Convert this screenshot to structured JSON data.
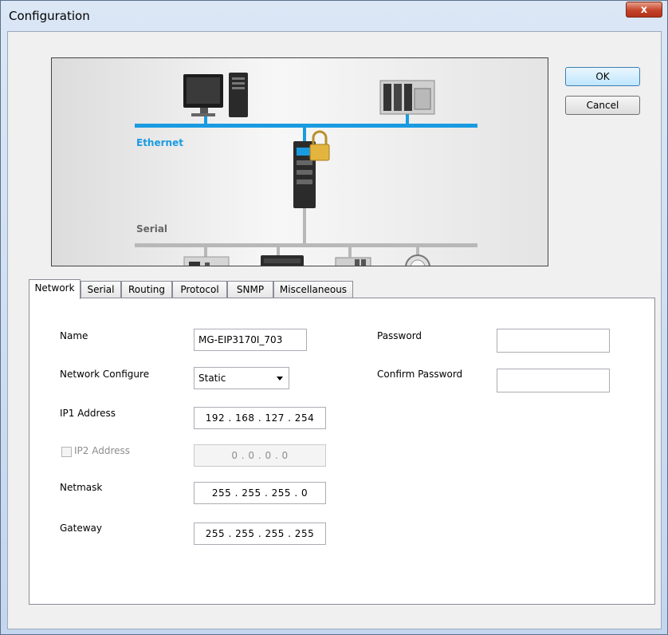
{
  "window": {
    "title": "Configuration",
    "close_label": "x"
  },
  "diagram": {
    "ethernet_label": "Ethernet",
    "serial_label": "Serial"
  },
  "buttons": {
    "ok": "OK",
    "cancel": "Cancel"
  },
  "tabs": [
    {
      "label": "Network",
      "active": true
    },
    {
      "label": "Serial",
      "active": false
    },
    {
      "label": "Routing",
      "active": false
    },
    {
      "label": "Protocol",
      "active": false
    },
    {
      "label": "SNMP",
      "active": false
    },
    {
      "label": "Miscellaneous",
      "active": false
    }
  ],
  "network": {
    "name_label": "Name",
    "name_value": "MG-EIP3170I_703",
    "network_configure_label": "Network Configure",
    "network_configure_value": "Static",
    "ip1_label": "IP1 Address",
    "ip1_value": "192 . 168 . 127 . 254",
    "ip2_label": "IP2 Address",
    "ip2_value": "0  .  0  .  0  .  0",
    "ip2_checked": false,
    "netmask_label": "Netmask",
    "netmask_value": "255 . 255 . 255 .  0",
    "gateway_label": "Gateway",
    "gateway_value": "255 . 255 . 255 . 255",
    "password_label": "Password",
    "password_value": "",
    "confirm_password_label": "Confirm Password",
    "confirm_password_value": ""
  },
  "colors": {
    "ethernet_line": "#1a9be0",
    "serial_line": "#b8b8b8",
    "ethernet_text": "#1a9be0"
  }
}
